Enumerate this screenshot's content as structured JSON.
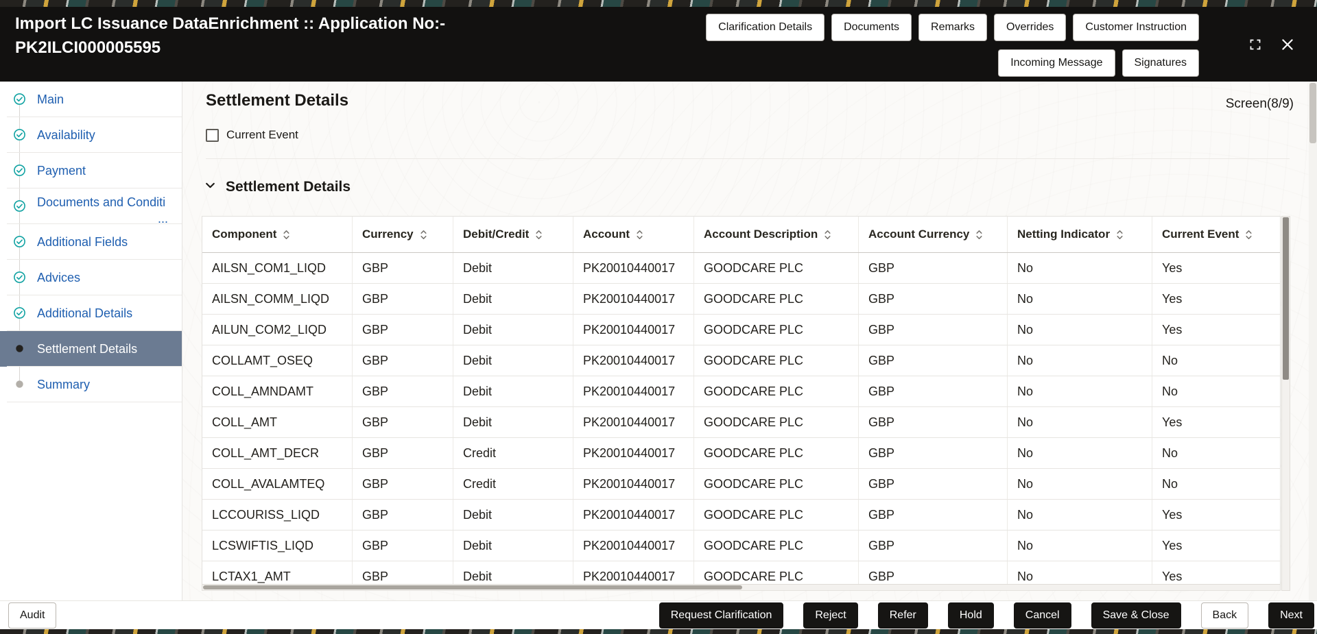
{
  "titlebar": {
    "title_line1": "Import LC Issuance DataEnrichment :: Application No:-",
    "title_line2": "PK2ILCI000005595"
  },
  "header": {
    "buttons_row1": [
      "Clarification Details",
      "Documents",
      "Remarks",
      "Overrides",
      "Customer Instruction"
    ],
    "buttons_row2": [
      "Incoming Message",
      "Signatures"
    ]
  },
  "sidebar": {
    "items": [
      {
        "label": "Main",
        "state": "done"
      },
      {
        "label": "Availability",
        "state": "done"
      },
      {
        "label": "Payment",
        "state": "done"
      },
      {
        "label": "Documents and Conditi",
        "sub": "...",
        "state": "done"
      },
      {
        "label": "Additional Fields",
        "state": "done"
      },
      {
        "label": "Advices",
        "state": "done"
      },
      {
        "label": "Additional Details",
        "state": "done"
      },
      {
        "label": "Settlement Details",
        "state": "active"
      },
      {
        "label": "Summary",
        "state": "pending"
      }
    ]
  },
  "main": {
    "page_title": "Settlement Details",
    "screen_indicator": "Screen(8/9)",
    "current_event_checkbox": {
      "label": "Current Event",
      "checked": false
    },
    "section": {
      "title": "Settlement Details",
      "expanded": true
    }
  },
  "table": {
    "columns": [
      "Component",
      "Currency",
      "Debit/Credit",
      "Account",
      "Account Description",
      "Account Currency",
      "Netting Indicator",
      "Current Event"
    ],
    "rows": [
      [
        "AILSN_COM1_LIQD",
        "GBP",
        "Debit",
        "PK20010440017",
        "GOODCARE PLC",
        "GBP",
        "No",
        "Yes"
      ],
      [
        "AILSN_COMM_LIQD",
        "GBP",
        "Debit",
        "PK20010440017",
        "GOODCARE PLC",
        "GBP",
        "No",
        "Yes"
      ],
      [
        "AILUN_COM2_LIQD",
        "GBP",
        "Debit",
        "PK20010440017",
        "GOODCARE PLC",
        "GBP",
        "No",
        "Yes"
      ],
      [
        "COLLAMT_OSEQ",
        "GBP",
        "Debit",
        "PK20010440017",
        "GOODCARE PLC",
        "GBP",
        "No",
        "No"
      ],
      [
        "COLL_AMNDAMT",
        "GBP",
        "Debit",
        "PK20010440017",
        "GOODCARE PLC",
        "GBP",
        "No",
        "No"
      ],
      [
        "COLL_AMT",
        "GBP",
        "Debit",
        "PK20010440017",
        "GOODCARE PLC",
        "GBP",
        "No",
        "Yes"
      ],
      [
        "COLL_AMT_DECR",
        "GBP",
        "Credit",
        "PK20010440017",
        "GOODCARE PLC",
        "GBP",
        "No",
        "No"
      ],
      [
        "COLL_AVALAMTEQ",
        "GBP",
        "Credit",
        "PK20010440017",
        "GOODCARE PLC",
        "GBP",
        "No",
        "No"
      ],
      [
        "LCCOURISS_LIQD",
        "GBP",
        "Debit",
        "PK20010440017",
        "GOODCARE PLC",
        "GBP",
        "No",
        "Yes"
      ],
      [
        "LCSWIFTIS_LIQD",
        "GBP",
        "Debit",
        "PK20010440017",
        "GOODCARE PLC",
        "GBP",
        "No",
        "Yes"
      ],
      [
        "LCTAX1_AMT",
        "GBP",
        "Debit",
        "PK20010440017",
        "GOODCARE PLC",
        "GBP",
        "No",
        "Yes"
      ]
    ]
  },
  "footer": {
    "audit_label": "Audit",
    "actions": [
      {
        "label": "Request Clarification",
        "variant": "dark"
      },
      {
        "label": "Reject",
        "variant": "dark"
      },
      {
        "label": "Refer",
        "variant": "dark"
      },
      {
        "label": "Hold",
        "variant": "dark"
      },
      {
        "label": "Cancel",
        "variant": "dark"
      },
      {
        "label": "Save & Close",
        "variant": "dark"
      },
      {
        "label": "Back",
        "variant": "light"
      },
      {
        "label": "Next",
        "variant": "dark"
      }
    ]
  },
  "colors": {
    "header_bg": "#121110",
    "link_blue": "#1f5fb0",
    "step_teal": "#12a3a3",
    "active_nav_bg": "#6b7b92",
    "dark_button_bg": "#161513"
  }
}
